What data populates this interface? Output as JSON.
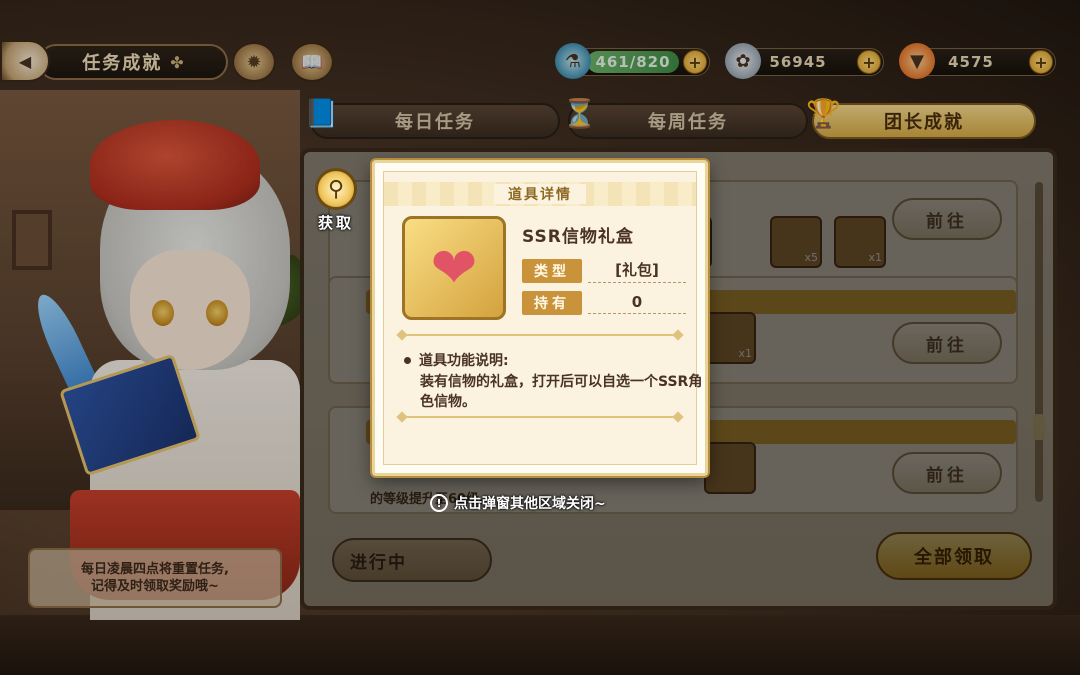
{
  "topbar": {
    "title": "任务成就",
    "resources": [
      {
        "name": "stamina",
        "value": "461/820",
        "icon": "potion-icon"
      },
      {
        "name": "coins",
        "value": "56945",
        "icon": "coin-icon"
      },
      {
        "name": "carrots",
        "value": "4575",
        "icon": "carrot-icon"
      }
    ]
  },
  "tabs": [
    {
      "label": "每日任务",
      "active": false
    },
    {
      "label": "每周任务",
      "active": false
    },
    {
      "label": "团长成就",
      "active": true
    }
  ],
  "task_list": {
    "goto_label": "前往",
    "reward_counts": [
      "x1",
      "x5",
      "x1",
      "x1"
    ],
    "last_desc": "的等级提升至60级。",
    "status_label": "进行中",
    "claim_all_label": "全部领取"
  },
  "tip": {
    "line1": "每日凌晨四点将重置任务,",
    "line2": "记得及时领取奖励哦~"
  },
  "acquire": {
    "label": "获取"
  },
  "popup": {
    "header": "道具详情",
    "item_name": "SSR信物礼盒",
    "type_label": "类型",
    "type_value": "[礼包]",
    "owned_label": "持有",
    "owned_value": "0",
    "desc_heading": "道具功能说明:",
    "desc_text": "装有信物的礼盒，打开后可以自选一个SSR角色信物。"
  },
  "close_hint": "点击弹窗其他区域关闭~",
  "colors": {
    "accent_gold": "#d8a73e",
    "panel_brown": "#6a4d30",
    "popup_bg": "#fbf3df"
  }
}
